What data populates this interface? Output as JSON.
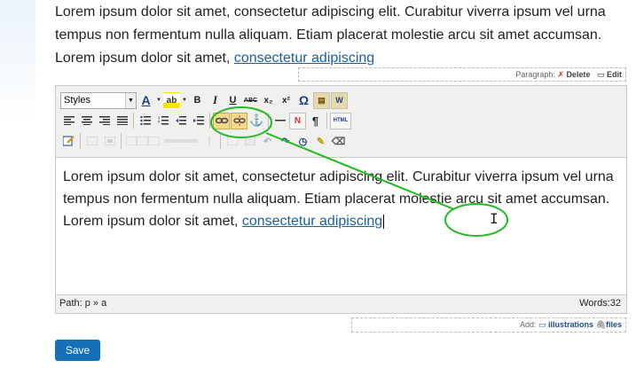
{
  "intro": {
    "text": "Lorem ipsum dolor sit amet, consectetur adipiscing elit. Curabitur viverra ipsum vel urna tempus non fermentum nulla aliquam. Etiam placerat molestie arcu sit amet accumsan. Lorem ipsum dolor sit amet, ",
    "link": "consectetur adipiscing"
  },
  "paragraph_bar": {
    "label": "Paragraph:",
    "delete_label": "Delete",
    "edit_label": "Edit"
  },
  "toolbar": {
    "styles_label": "Styles",
    "buttons_row1": [
      {
        "name": "text-color-icon",
        "glyph": "A"
      },
      {
        "name": "highlight-icon",
        "glyph": "ab"
      },
      {
        "name": "bold-icon",
        "glyph": "B"
      },
      {
        "name": "italic-icon",
        "glyph": "I"
      },
      {
        "name": "underline-icon",
        "glyph": "U"
      },
      {
        "name": "strikethrough-icon",
        "glyph": "ABC"
      },
      {
        "name": "subscript-icon",
        "glyph": "x₂"
      },
      {
        "name": "superscript-icon",
        "glyph": "x²"
      },
      {
        "name": "special-char-icon",
        "glyph": "Ω"
      },
      {
        "name": "paste-icon",
        "glyph": "📋"
      },
      {
        "name": "paste-word-icon",
        "glyph": "W"
      }
    ],
    "html_label": "HTML"
  },
  "editor": {
    "text": "Lorem ipsum dolor sit amet, consectetur adipiscing elit. Curabitur viverra ipsum vel urna tempus non fermentum nulla aliquam. Etiam placerat molestie arcu sit amet accumsan. Lorem ipsum dolor sit amet, ",
    "link": "consectetur adipiscing",
    "path": "Path: p » a",
    "words": "Words:32"
  },
  "add_bar": {
    "label": "Add:",
    "illustrations_label": "illustrations",
    "files_label": "files"
  },
  "save_label": "Save",
  "colors": {
    "link": "#1a5fa8",
    "annotation": "#22bb22",
    "save_button": "#1570b8",
    "active_button": "#f7d98c"
  }
}
